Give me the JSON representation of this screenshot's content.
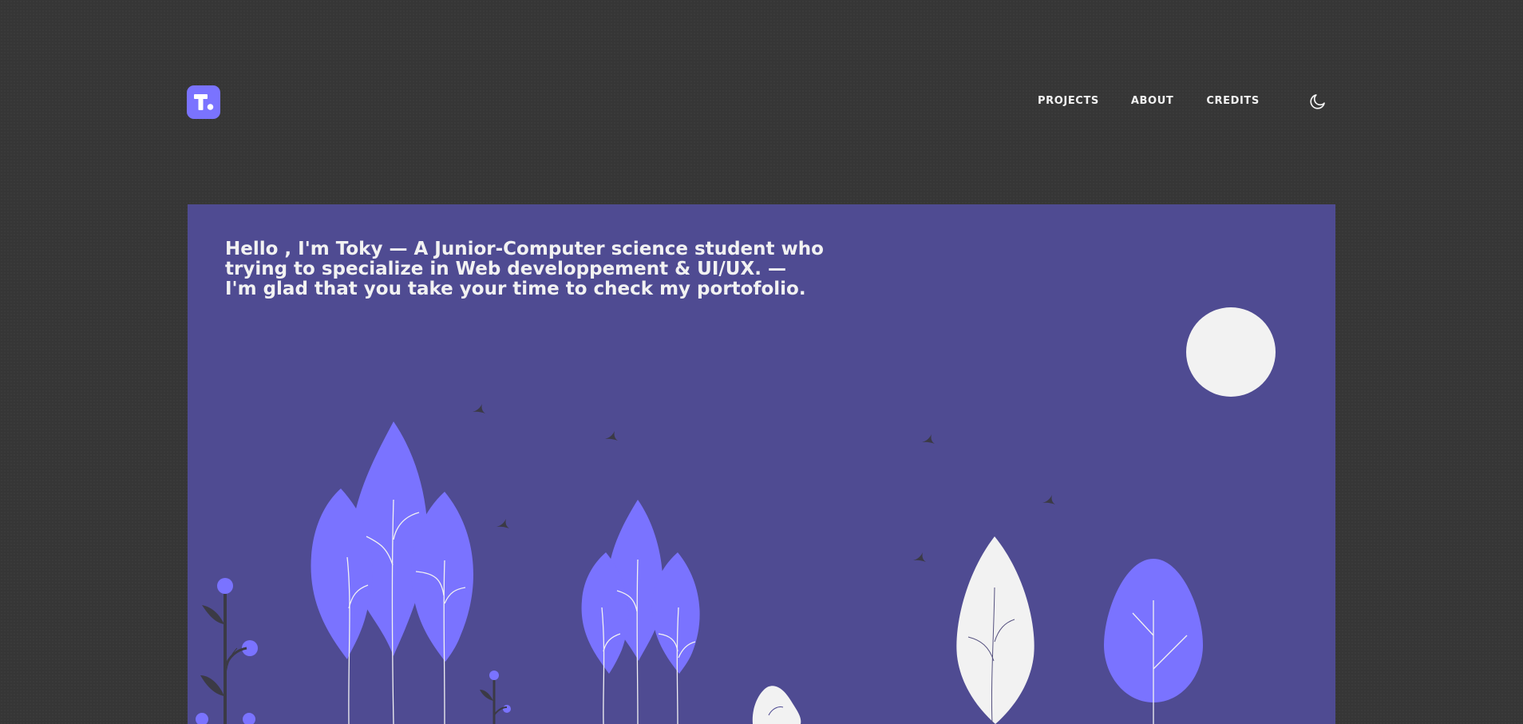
{
  "header": {
    "logo": {
      "icon": "letter-t-logo-icon",
      "color": "#7a73ff"
    },
    "nav": [
      {
        "label": "PROJECTS"
      },
      {
        "label": "ABOUT"
      },
      {
        "label": "CREDITS"
      }
    ],
    "theme_toggle": {
      "icon": "moon-icon"
    }
  },
  "hero": {
    "lines": [
      "Hello , I'm Toky — A Junior-Computer science student who",
      "trying to specialize in Web developpement & UI/UX. —",
      "I'm glad that you take your time to check my portofolio."
    ],
    "background_color": "#4f4b92"
  },
  "colors": {
    "page_background": "#363636",
    "accent": "#7a73ff",
    "light": "#f2f2f2",
    "bird": "#3a3a3a"
  }
}
